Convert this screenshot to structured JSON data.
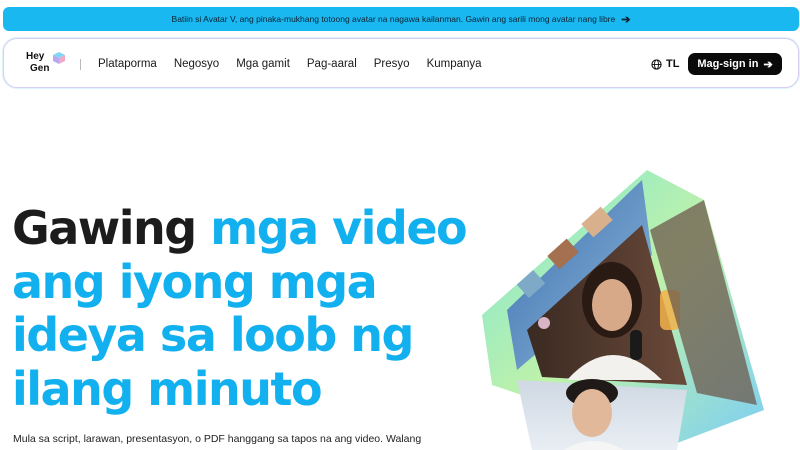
{
  "announcement": {
    "text": "Batiin si Avatar V, ang pinaka-mukhang totoong avatar na nagawa kailanman. Gawin ang sarili mong avatar nang libre",
    "arrow_icon": "arrow-right-icon"
  },
  "nav": {
    "logo_line1": "Hey",
    "logo_line2": "Gen",
    "items": [
      {
        "label": "Plataporma"
      },
      {
        "label": "Negosyo"
      },
      {
        "label": "Mga gamit"
      },
      {
        "label": "Pag-aaral"
      },
      {
        "label": "Presyo"
      },
      {
        "label": "Kumpanya"
      }
    ],
    "language": "TL",
    "language_icon": "globe-icon",
    "signin_label": "Mag-sign in",
    "signin_icon": "arrow-right-icon"
  },
  "hero": {
    "title_dark": "Gawing",
    "title_blue_1": "mga video",
    "title_line2": "ang iyong mga",
    "title_line3": "ideya sa loob ng",
    "title_line4": "ilang minuto",
    "subtitle": "Mula sa script, larawan, presentasyon, o PDF hanggang sa tapos na ang video. Walang"
  },
  "colors": {
    "accent": "#12b0ef",
    "announcement_bg": "#19b8f0",
    "button_bg": "#0a0a0a"
  }
}
